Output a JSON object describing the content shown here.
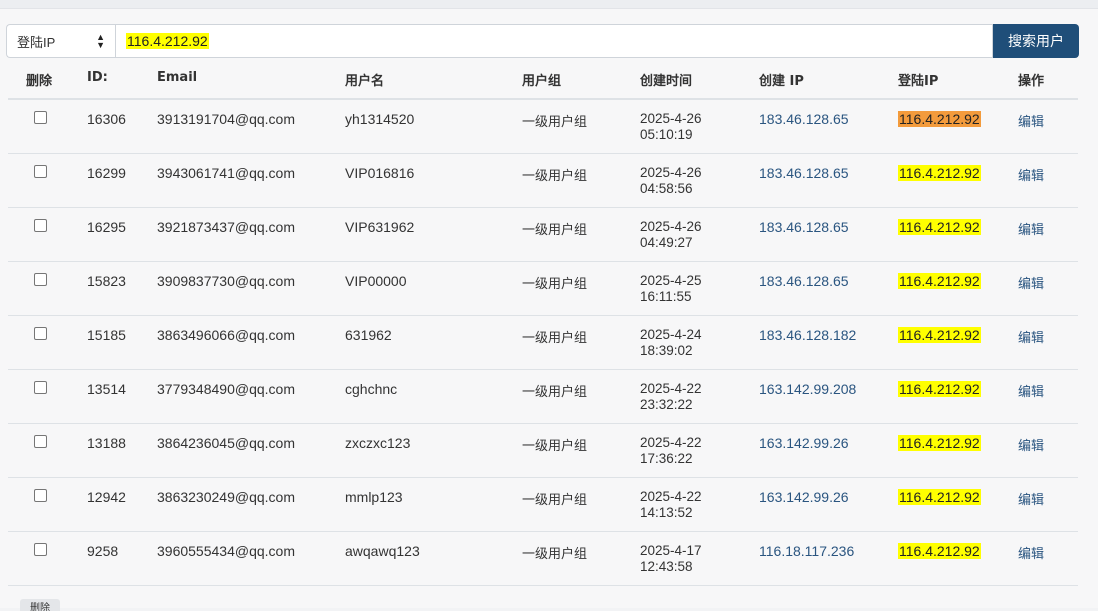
{
  "search": {
    "field_select": "登陆IP",
    "query": "116.4.212.92",
    "button_label": "搜索用户"
  },
  "table": {
    "headers": {
      "delete": "删除",
      "id": "ID:",
      "email": "Email",
      "username": "用户名",
      "group": "用户组",
      "created": "创建时间",
      "create_ip": "创建 IP",
      "login_ip": "登陆IP",
      "action": "操作"
    },
    "rows": [
      {
        "id": "16306",
        "email": "3913191704@qq.com",
        "username": "yh1314520",
        "group": "一级用户组",
        "date": "2025-4-26",
        "time": "05:10:19",
        "create_ip": "183.46.128.65",
        "login_ip": "116.4.212.92",
        "action": "编辑"
      },
      {
        "id": "16299",
        "email": "3943061741@qq.com",
        "username": "VIP016816",
        "group": "一级用户组",
        "date": "2025-4-26",
        "time": "04:58:56",
        "create_ip": "183.46.128.65",
        "login_ip": "116.4.212.92",
        "action": "编辑"
      },
      {
        "id": "16295",
        "email": "3921873437@qq.com",
        "username": "VIP631962",
        "group": "一级用户组",
        "date": "2025-4-26",
        "time": "04:49:27",
        "create_ip": "183.46.128.65",
        "login_ip": "116.4.212.92",
        "action": "编辑"
      },
      {
        "id": "15823",
        "email": "3909837730@qq.com",
        "username": "VIP00000",
        "group": "一级用户组",
        "date": "2025-4-25",
        "time": "16:11:55",
        "create_ip": "183.46.128.65",
        "login_ip": "116.4.212.92",
        "action": "编辑"
      },
      {
        "id": "15185",
        "email": "3863496066@qq.com",
        "username": "631962",
        "group": "一级用户组",
        "date": "2025-4-24",
        "time": "18:39:02",
        "create_ip": "183.46.128.182",
        "login_ip": "116.4.212.92",
        "action": "编辑"
      },
      {
        "id": "13514",
        "email": "3779348490@qq.com",
        "username": "cghchnc",
        "group": "一级用户组",
        "date": "2025-4-22",
        "time": "23:32:22",
        "create_ip": "163.142.99.208",
        "login_ip": "116.4.212.92",
        "action": "编辑"
      },
      {
        "id": "13188",
        "email": "3864236045@qq.com",
        "username": "zxczxc123",
        "group": "一级用户组",
        "date": "2025-4-22",
        "time": "17:36:22",
        "create_ip": "163.142.99.26",
        "login_ip": "116.4.212.92",
        "action": "编辑"
      },
      {
        "id": "12942",
        "email": "3863230249@qq.com",
        "username": "mmlp123",
        "group": "一级用户组",
        "date": "2025-4-22",
        "time": "14:13:52",
        "create_ip": "163.142.99.26",
        "login_ip": "116.4.212.92",
        "action": "编辑"
      },
      {
        "id": "9258",
        "email": "3960555434@qq.com",
        "username": "awqawq123",
        "group": "一级用户组",
        "date": "2025-4-17",
        "time": "12:43:58",
        "create_ip": "116.18.117.236",
        "login_ip": "116.4.212.92",
        "action": "编辑"
      }
    ]
  },
  "footer": {
    "delete_button_label": "删除"
  },
  "colors": {
    "primary_button": "#1f4e79",
    "highlight_yellow": "#ffff00",
    "highlight_active": "#f39b3c",
    "link": "#2a5580"
  }
}
